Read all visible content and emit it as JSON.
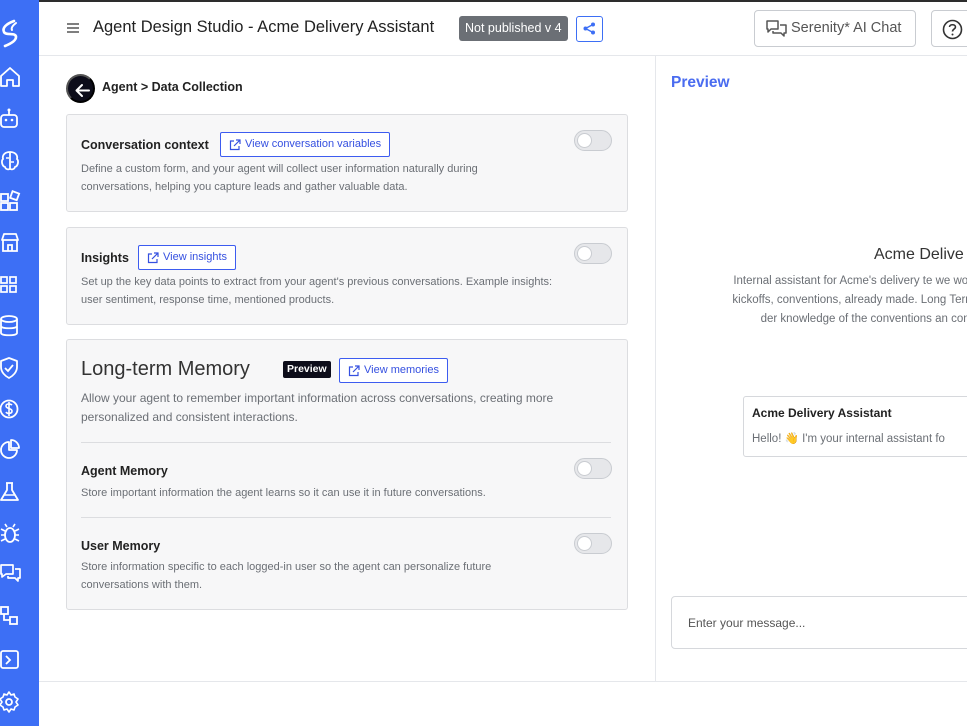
{
  "header": {
    "title": "Agent Design Studio - Acme Delivery Assistant",
    "status": "Not published v 4",
    "chat_button_label": "Serenity* AI Chat"
  },
  "breadcrumb": "Agent > Data Collection",
  "conversation_context": {
    "title": "Conversation context",
    "link_label": "View conversation variables",
    "description": "Define a custom form, and your agent will collect user information naturally during conversations, helping you capture leads and gather valuable data.",
    "enabled": false
  },
  "insights": {
    "title": "Insights",
    "link_label": "View insights",
    "description": "Set up the key data points to extract from your agent's previous conversations. Example insights: user sentiment, response time, mentioned products.",
    "enabled": false
  },
  "long_term_memory": {
    "title": "Long-term Memory",
    "badge": "Preview",
    "link_label": "View memories",
    "description": "Allow your agent to remember important information across conversations, creating more personalized and consistent interactions.",
    "agent_memory": {
      "title": "Agent Memory",
      "description": "Store important information the agent learns so it can use it in future conversations.",
      "enabled": false
    },
    "user_memory": {
      "title": "User Memory",
      "description": "Store information specific to each logged-in user so the agent can personalize future conversations with them.",
      "enabled": false
    }
  },
  "preview": {
    "title": "Preview",
    "agent_name": "Acme Delive",
    "agent_description": "Internal assistant for Acme's delivery te we work: project kickoffs, conventions, already made. Long Term Memory der knowledge of the conventions an convers",
    "bubble_name": "Acme Delivery Assistant",
    "bubble_message": "Hello! 👋 I'm your internal assistant fo",
    "input_placeholder": "Enter your message..."
  },
  "colors": {
    "sidebar": "#3d6ff5",
    "accent": "#3550e0",
    "preview_title": "#4a6cf0",
    "badge_dark": "#0d0d1a",
    "status_badge": "#6b6f75"
  },
  "sidebar_icons": [
    "logo-icon",
    "home-icon",
    "robot-icon",
    "brain-icon",
    "blocks-icon",
    "store-icon",
    "apps-grid-icon",
    "database-icon",
    "shield-check-icon",
    "dollar-icon",
    "pie-chart-icon",
    "flask-icon",
    "bug-icon",
    "chat-icon",
    "workflow-icon",
    "terminal-icon",
    "gear-icon"
  ]
}
